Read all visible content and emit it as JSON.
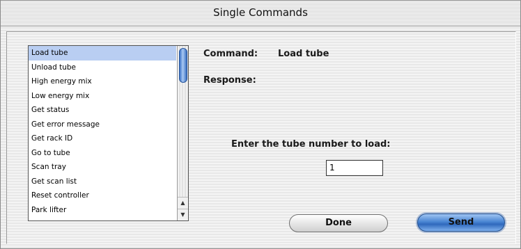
{
  "window": {
    "title": "Single Commands"
  },
  "list": {
    "selected_index": 0,
    "items": [
      "Load tube",
      "Unload tube",
      "High energy mix",
      "Low energy mix",
      "Get status",
      "Get error message",
      "Get rack ID",
      "Go to tube",
      "Scan tray",
      "Get scan list",
      "Reset controller",
      "Park lifter"
    ],
    "scroll_position": 0.0
  },
  "command": {
    "label": "Command:",
    "value": "Load tube"
  },
  "response": {
    "label": "Response:",
    "value": ""
  },
  "prompt": {
    "text": "Enter the tube number to load:"
  },
  "tube_input": {
    "value": "1"
  },
  "buttons": {
    "done": "Done",
    "send": "Send"
  },
  "colors": {
    "selection": "#b9cef2",
    "default_button": "#4a86d3",
    "scroll_thumb": "#3d74c8"
  }
}
